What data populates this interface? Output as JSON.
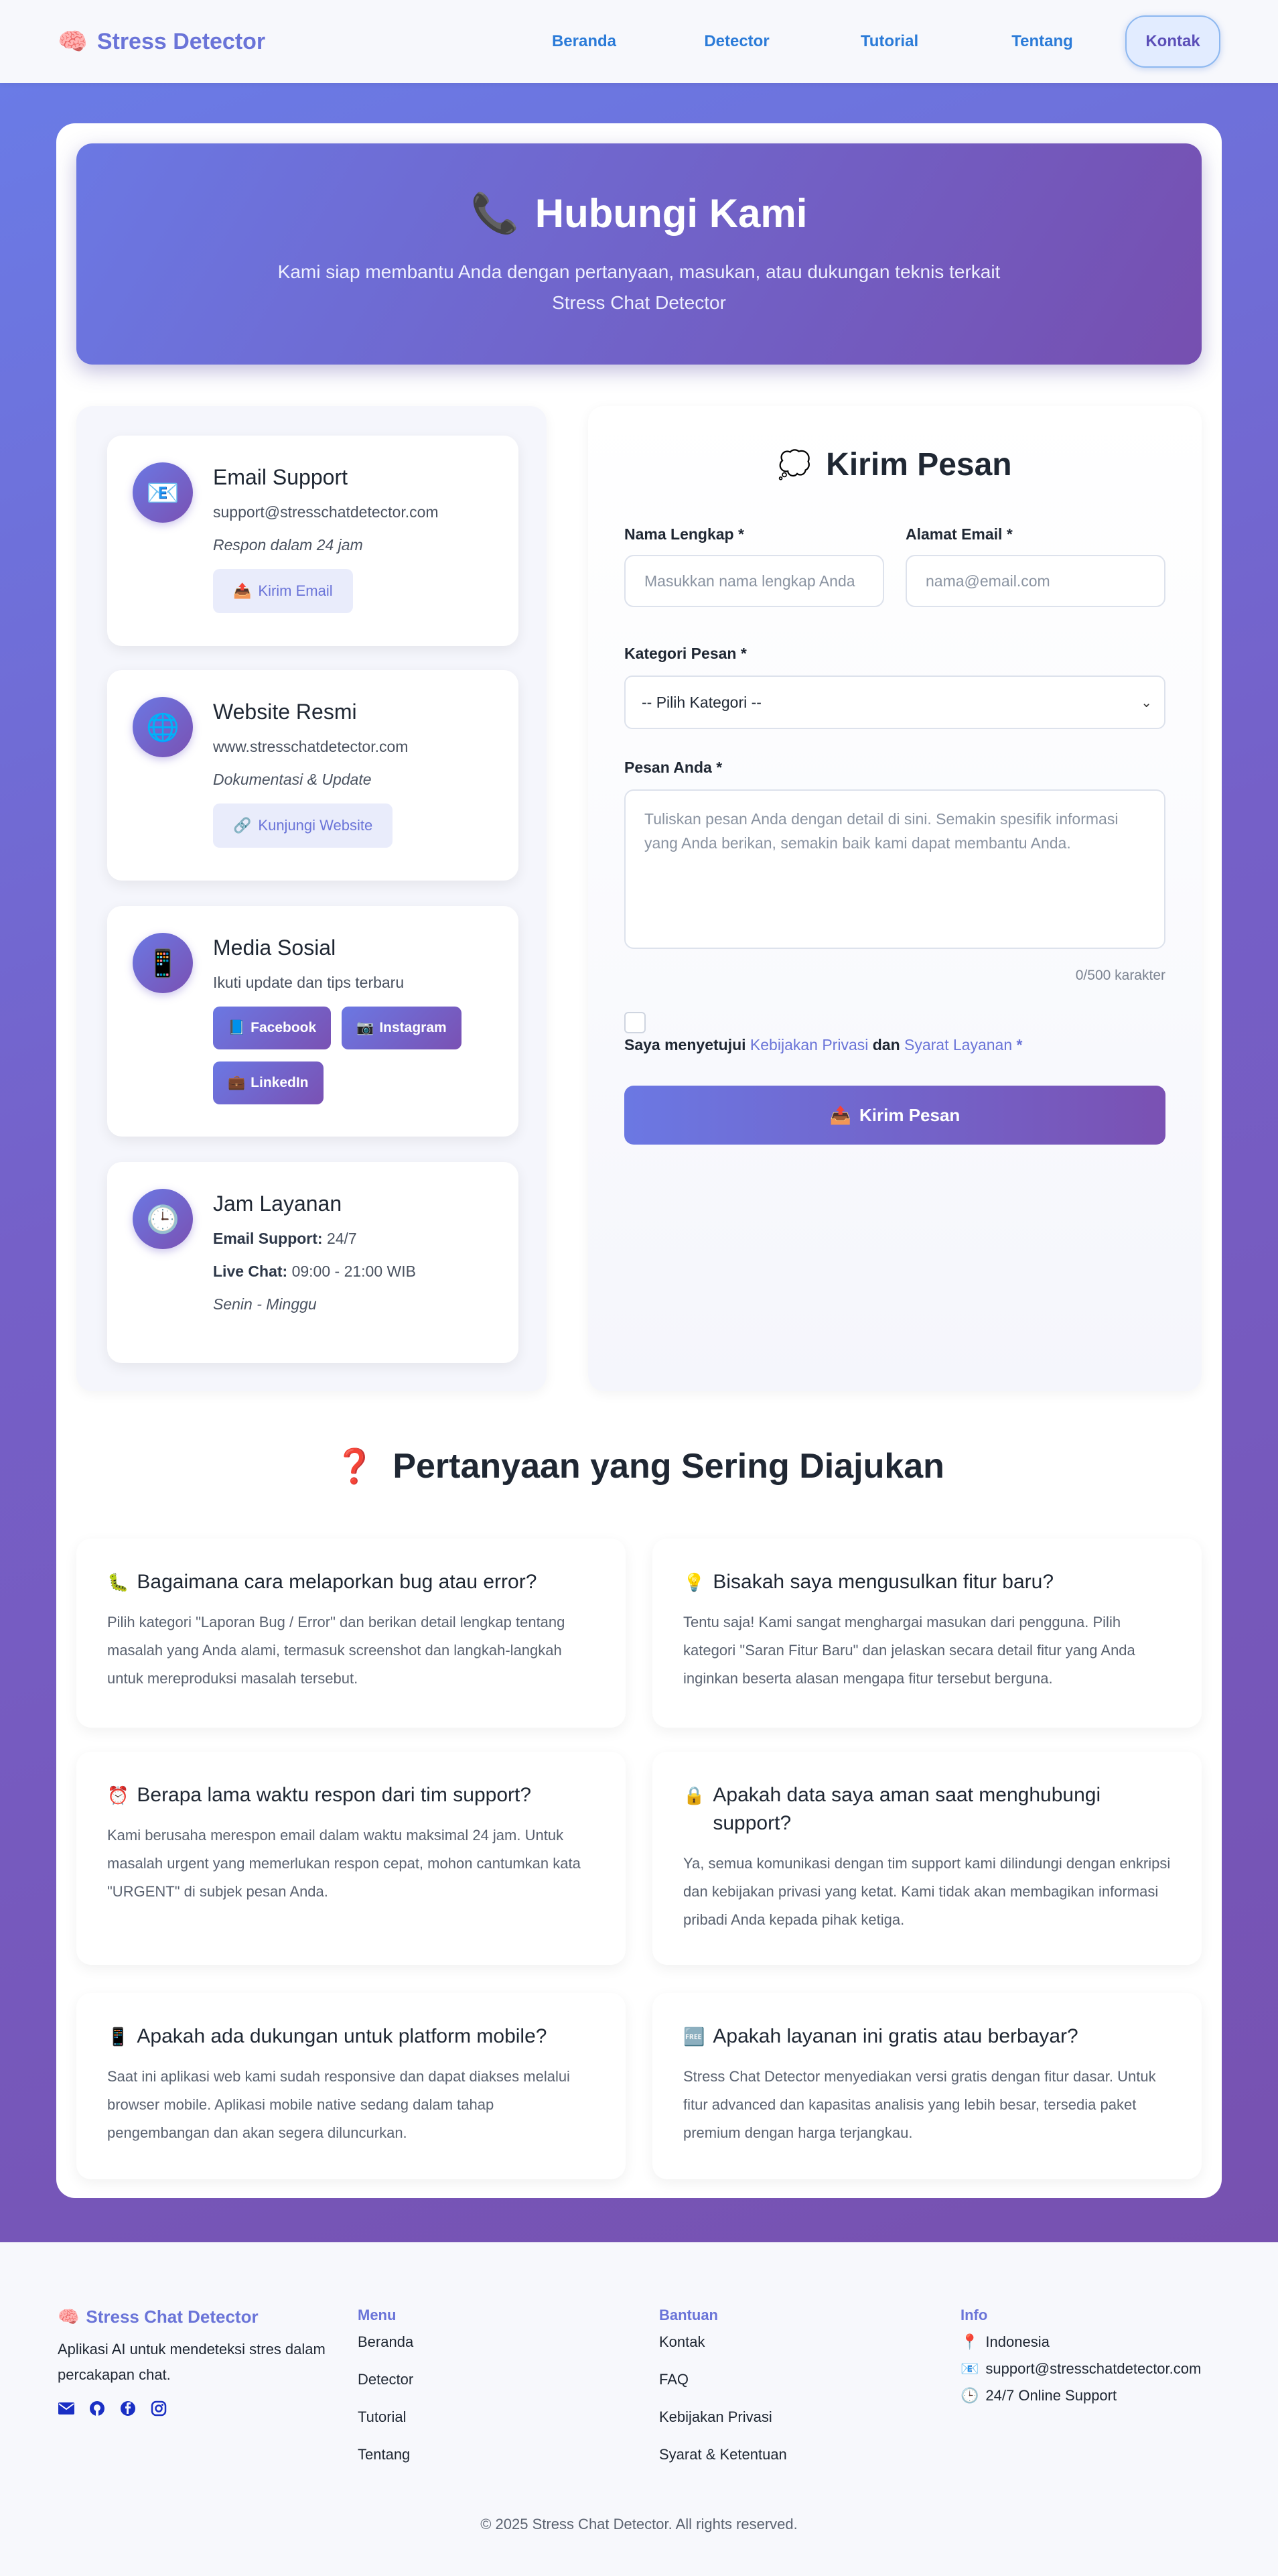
{
  "nav": {
    "brand": "Stress Detector",
    "links": [
      "Beranda",
      "Detector",
      "Tutorial",
      "Tentang"
    ],
    "active": "Kontak"
  },
  "header": {
    "title": "Hubungi Kami",
    "subtitle": "Kami siap membantu Anda dengan pertanyaan, masukan, atau dukungan teknis terkait Stress Chat Detector"
  },
  "contact": {
    "email": {
      "title": "Email Support",
      "address": "support@stresschatdetector.com",
      "note": "Respon dalam 24 jam",
      "button": "Kirim Email"
    },
    "website": {
      "title": "Website Resmi",
      "url": "www.stresschatdetector.com",
      "note": "Dokumentasi & Update",
      "button": "Kunjungi Website"
    },
    "social": {
      "title": "Media Sosial",
      "note": "Ikuti update dan tips terbaru",
      "facebook": "Facebook",
      "instagram": "Instagram",
      "linkedin": "LinkedIn"
    },
    "hours": {
      "title": "Jam Layanan",
      "email_label": "Email Support:",
      "email_value": "24/7",
      "chat_label": "Live Chat:",
      "chat_value": "09:00 - 21:00 WIB",
      "days": "Senin - Minggu"
    }
  },
  "form": {
    "title": "Kirim Pesan",
    "name_label": "Nama Lengkap *",
    "name_placeholder": "Masukkan nama lengkap Anda",
    "email_label": "Alamat Email *",
    "email_placeholder": "nama@email.com",
    "category_label": "Kategori Pesan *",
    "category_value": "-- Pilih Kategori --",
    "message_label": "Pesan Anda *",
    "message_placeholder": "Tuliskan pesan Anda dengan detail di sini. Semakin spesifik informasi yang Anda berikan, semakin baik kami dapat membantu Anda.",
    "char_count": "0/500 karakter",
    "agree_prefix": "Saya menyetujui",
    "privacy_link": "Kebijakan Privasi",
    "agree_and": "dan",
    "terms_link": "Syarat Layanan",
    "agree_star": "*",
    "submit": "Kirim Pesan"
  },
  "faq": {
    "title": "Pertanyaan yang Sering Diajukan",
    "items": [
      {
        "q": "Bagaimana cara melaporkan bug atau error?",
        "a": "Pilih kategori \"Laporan Bug / Error\" dan berikan detail lengkap tentang masalah yang Anda alami, termasuk screenshot dan langkah-langkah untuk mereproduksi masalah tersebut."
      },
      {
        "q": "Bisakah saya mengusulkan fitur baru?",
        "a": "Tentu saja! Kami sangat menghargai masukan dari pengguna. Pilih kategori \"Saran Fitur Baru\" dan jelaskan secara detail fitur yang Anda inginkan beserta alasan mengapa fitur tersebut berguna."
      },
      {
        "q": "Berapa lama waktu respon dari tim support?",
        "a": "Kami berusaha merespon email dalam waktu maksimal 24 jam. Untuk masalah urgent yang memerlukan respon cepat, mohon cantumkan kata \"URGENT\" di subjek pesan Anda."
      },
      {
        "q": "Apakah data saya aman saat menghubungi support?",
        "a": "Ya, semua komunikasi dengan tim support kami dilindungi dengan enkripsi dan kebijakan privasi yang ketat. Kami tidak akan membagikan informasi pribadi Anda kepada pihak ketiga."
      },
      {
        "q": "Apakah ada dukungan untuk platform mobile?",
        "a": "Saat ini aplikasi web kami sudah responsive dan dapat diakses melalui browser mobile. Aplikasi mobile native sedang dalam tahap pengembangan dan akan segera diluncurkan."
      },
      {
        "q": "Apakah layanan ini gratis atau berbayar?",
        "a": "Stress Chat Detector menyediakan versi gratis dengan fitur dasar. Untuk fitur advanced dan kapasitas analisis yang lebih besar, tersedia paket premium dengan harga terjangkau."
      }
    ]
  },
  "footer": {
    "brand": "Stress Chat Detector",
    "desc": "Aplikasi AI untuk mendeteksi stres dalam percakapan chat.",
    "menu_head": "Menu",
    "menu": [
      "Beranda",
      "Detector",
      "Tutorial",
      "Tentang"
    ],
    "help_head": "Bantuan",
    "help": [
      "Kontak",
      "FAQ",
      "Kebijakan Privasi",
      "Syarat & Ketentuan"
    ],
    "info_head": "Info",
    "info_location": "Indonesia",
    "info_email": "support@stresschatdetector.com",
    "info_support": "24/7 Online Support",
    "copyright": "© 2025 Stress Chat Detector. All rights reserved."
  }
}
